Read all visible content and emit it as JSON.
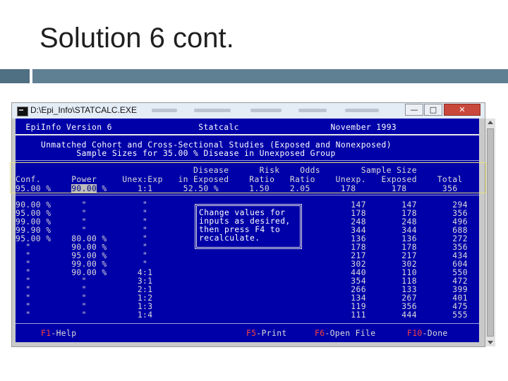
{
  "slide": {
    "title": "Solution 6 cont."
  },
  "window": {
    "title": "D:\\Epi_Info\\STATCALC.EXE",
    "buttons": {
      "minimize": "—",
      "maximize": "□",
      "close": "✕"
    }
  },
  "console": {
    "lines": [
      "  EpiInfo Version 6                 Statcalc                  November 1993",
      "",
      "     Unmatched Cohort and Cross-Sectional Studies (Exposed and Nonexposed)",
      "            Sample Sizes for 35.00 % Disease in Unexposed Group",
      "                                   Disease      Risk    Odds        Sample Size",
      "Conf.      Power     Unex:Exp   in Exposed    Ratio   Ratio    Unexp.   Exposed    Total",
      "95.00 %    ",
      "90.00 %      \"           \"                                        147       147       294",
      "95.00 %      \"           \"                                        178       178       356",
      "99.00 %      \"           \"                                        248       248       496",
      "99.90 %      \"           \"                                        344       344       688",
      "95.00 %    80.00 %       \"                                        136       136       272",
      "  \"        90.00 %       \"                                        178       178       356",
      "  \"        95.00 %       \"                                        217       217       434",
      "  \"        99.00 %       \"                                        302       302       604",
      "  \"        90.00 %      4:1                                       440       110       550",
      "  \"          \"          3:1                                       354       118       472",
      "  \"          \"          2:1                                       266       133       399",
      "  \"          \"          1:2                                       134       267       401",
      "  \"          \"          1:3                                       119       356       475",
      "  \"          \"          1:4                                       111       444       555"
    ],
    "first_row_power": "90.00",
    "first_row_rest": " %      1:1      52.50 %      1.50    2.05      178       178       356",
    "message": [
      "Change values for",
      "inputs as desired,",
      "then press F4 to",
      "recalculate."
    ],
    "footer": {
      "f1_key": "F1",
      "f1_label": "-Help",
      "f5_key": "F5",
      "f5_label": "-Print",
      "f6_key": "F6",
      "f6_label": "-Open File",
      "f10_key": "F10",
      "f10_label": "-Done"
    }
  }
}
